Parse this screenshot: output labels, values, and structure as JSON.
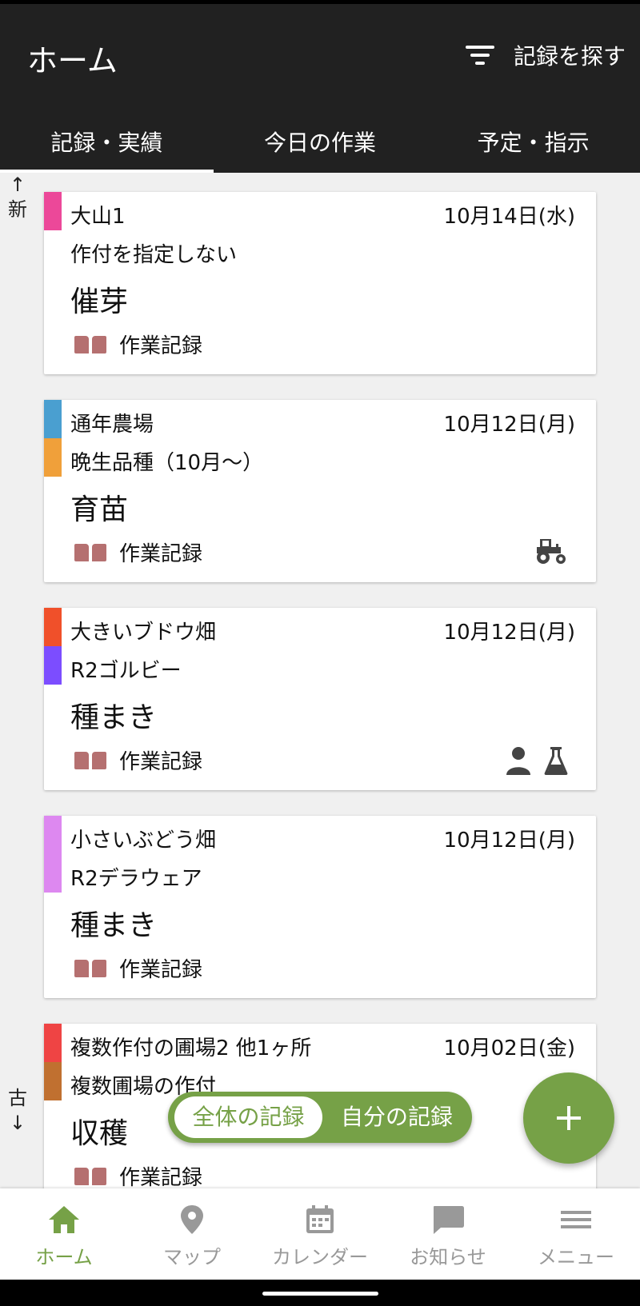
{
  "header": {
    "title": "ホーム",
    "search_label": "記録を探す",
    "tabs": [
      {
        "label": "記録・実績",
        "active": true
      },
      {
        "label": "今日の作業",
        "active": false
      },
      {
        "label": "予定・指示",
        "active": false
      }
    ]
  },
  "order": {
    "newer": "↑\n新",
    "older": "古\n↓"
  },
  "records": [
    {
      "field": "大山1",
      "date": "10月14日(水)",
      "crop": "作付を指定しない",
      "task": "催芽",
      "type": "作業記録",
      "bars": [
        "#ec4899"
      ],
      "icons": []
    },
    {
      "field": "通年農場",
      "date": "10月12日(月)",
      "crop": "晩生品種（10月～）",
      "task": "育苗",
      "type": "作業記録",
      "bars": [
        "#4a9fd0",
        "#f0a03a"
      ],
      "icons": [
        "tractor-icon"
      ]
    },
    {
      "field": "大きいブドウ畑",
      "date": "10月12日(月)",
      "crop": "R2ゴルビー",
      "task": "種まき",
      "type": "作業記録",
      "bars": [
        "#f0502a",
        "#7c4dff"
      ],
      "icons": [
        "person-icon",
        "flask-icon"
      ]
    },
    {
      "field": "小さいぶどう畑",
      "date": "10月12日(月)",
      "crop": "R2デラウェア",
      "task": "種まき",
      "type": "作業記録",
      "bars": [
        "#dd88f0"
      ],
      "icons": []
    },
    {
      "field": "複数作付の圃場2 他1ヶ所",
      "date": "10月02日(金)",
      "crop": "複数圃場の作付",
      "task": "収穫",
      "type": "作業記録",
      "bars": [
        "#ef4444",
        "#c07030"
      ],
      "icons": []
    }
  ],
  "toggle": {
    "all": "全体の記録",
    "mine": "自分の記録",
    "selected": "all"
  },
  "fab": {
    "label": "+"
  },
  "nav": [
    {
      "label": "ホーム",
      "icon": "home-icon",
      "active": true
    },
    {
      "label": "マップ",
      "icon": "map-pin-icon",
      "active": false
    },
    {
      "label": "カレンダー",
      "icon": "calendar-icon",
      "active": false
    },
    {
      "label": "お知らせ",
      "icon": "chat-icon",
      "active": false
    },
    {
      "label": "メニュー",
      "icon": "menu-icon",
      "active": false
    }
  ],
  "colors": {
    "accent": "#76a147",
    "header": "#212121",
    "book": "#b57070"
  }
}
